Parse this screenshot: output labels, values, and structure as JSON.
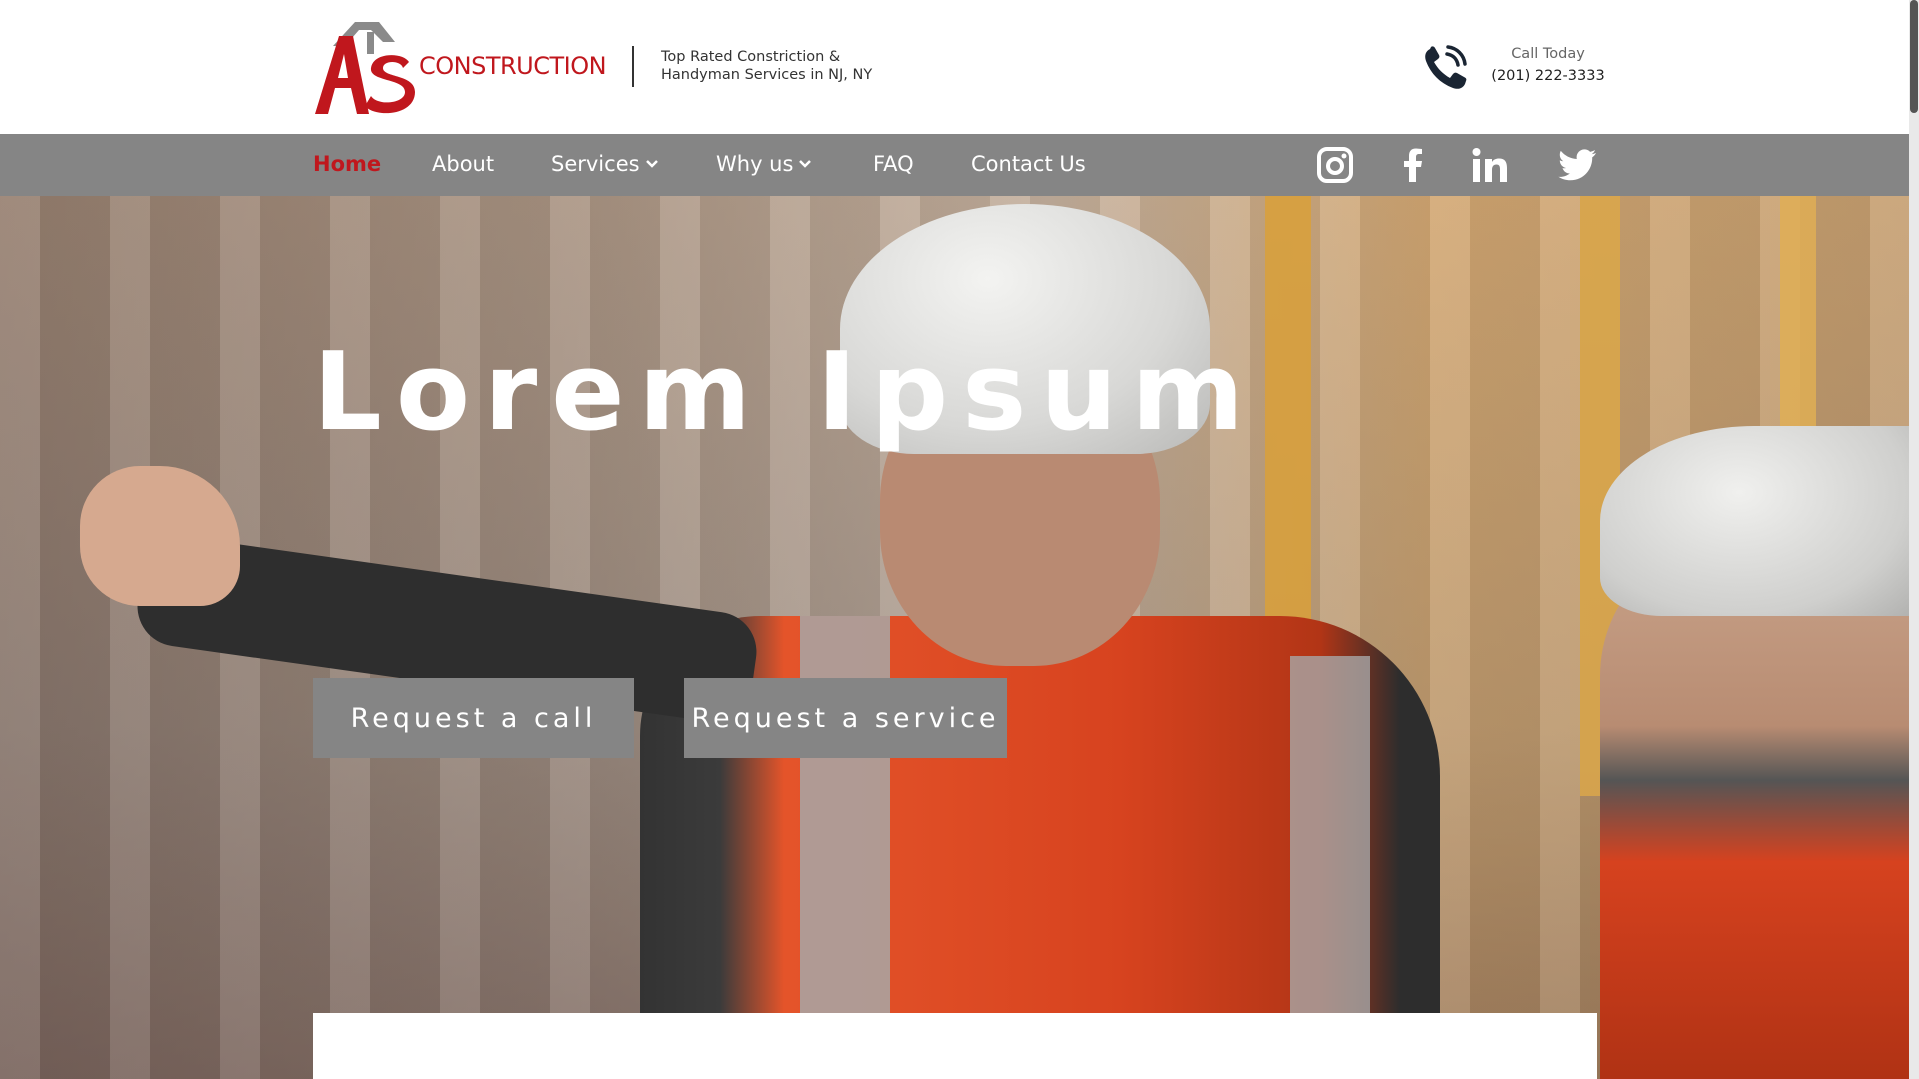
{
  "header": {
    "logo_word": "CONSTRUCTION",
    "tagline_line1": "Top Rated Constriction &",
    "tagline_line2": "Handyman Services in NJ, NY",
    "call_label": "Call Today",
    "call_number": "(201) 222-3333"
  },
  "nav": {
    "items": [
      {
        "label": "Home"
      },
      {
        "label": "About"
      },
      {
        "label": "Services"
      },
      {
        "label": "Why us"
      },
      {
        "label": "FAQ"
      },
      {
        "label": "Contact Us"
      }
    ],
    "social": [
      "instagram-icon",
      "facebook-icon",
      "linkedin-icon",
      "twitter-icon"
    ]
  },
  "hero": {
    "title": "Lorem Ipsum",
    "btn_call": "Request a call",
    "btn_service": "Request a service"
  },
  "colors": {
    "brand_red": "#c0171d",
    "nav_gray": "#858585",
    "logo_gray": "#8a8a8a"
  }
}
